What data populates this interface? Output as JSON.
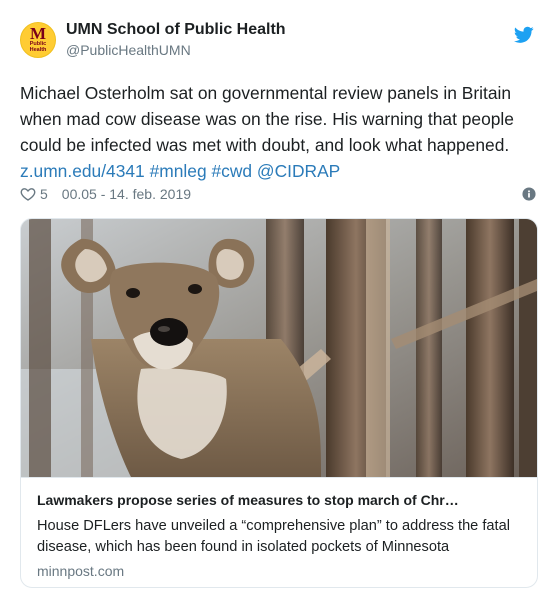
{
  "account": {
    "display_name": "UMN School of Public Health",
    "handle": "@PublicHealthUMN",
    "avatar_letter": "M",
    "avatar_sub": "Public Health",
    "avatar_color": "#ffcc33",
    "avatar_accent": "#7a0019"
  },
  "tweet": {
    "body": "Michael Osterholm sat on governmental review panels in Britain when mad cow disease was on the rise. His warning that people could be infected was met with doubt, and look what happened.",
    "links": [
      "z.umn.edu/4341",
      "#mnleg",
      "#cwd",
      "@CIDRAP"
    ],
    "link_color": "#2b7bb9"
  },
  "meta": {
    "like_count": "5",
    "timestamp": "00.05 - 14. feb. 2019"
  },
  "card": {
    "image_icon": "deer-photo",
    "title": "Lawmakers propose series of measures to stop march of Chr…",
    "description": "House DFLers have unveiled a “comprehensive plan” to address the fatal disease, which has been found in isolated pockets of Minnesota",
    "domain": "minnpost.com"
  },
  "icons": {
    "brand": "twitter-bird-icon",
    "like": "heart-icon",
    "info": "info-icon",
    "brand_color": "#1da1f2"
  }
}
